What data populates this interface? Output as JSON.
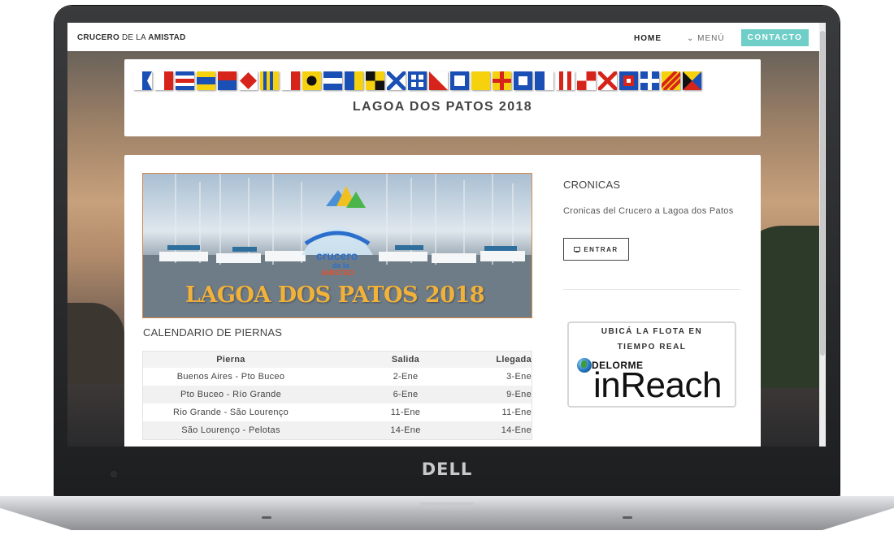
{
  "laptop": {
    "brand": "DELL"
  },
  "navbar": {
    "site_title_bold": "CRUCERO",
    "site_title_mid": "DE LA",
    "site_title_end": "AMISTAD",
    "home": "HOME",
    "menu": "⌄ MENÚ",
    "contact": "CONTACTO"
  },
  "header": {
    "title": "LAGOA DOS PATOS 2018"
  },
  "banner": {
    "logo_line1": "crucero",
    "logo_line2": "de la",
    "logo_line3": "AMISTAD",
    "overlay_text": "LAGOA DOS PATOS 2018"
  },
  "calendar": {
    "title": "CALENDARIO DE PIERNAS",
    "columns": [
      "Pierna",
      "Salida",
      "Llegada"
    ],
    "rows": [
      [
        "Buenos Aires - Pto Buceo",
        "2-Ene",
        "3-Ene"
      ],
      [
        "Pto Buceo - Río Grande",
        "6-Ene",
        "9-Ene"
      ],
      [
        "Rio Grande - São Lourenço",
        "11-Ene",
        "11-Ene"
      ],
      [
        "São Lourenço - Pelotas",
        "14-Ene",
        "14-Ene"
      ]
    ]
  },
  "sidebar": {
    "title": "CRONICAS",
    "text": "Cronicas del Crucero a Lagoa dos Patos",
    "button_label": "ENTRAR",
    "button_icon": "monitor-icon"
  },
  "inreach": {
    "line1": "UBICÁ LA FLOTA EN",
    "line2": "TIEMPO REAL",
    "brand": "DELORME",
    "product": "inReach"
  },
  "colors": {
    "accent": "#6fcfc8",
    "banner_text": "#f2b23a",
    "logo_blue": "#2b6fcc"
  }
}
